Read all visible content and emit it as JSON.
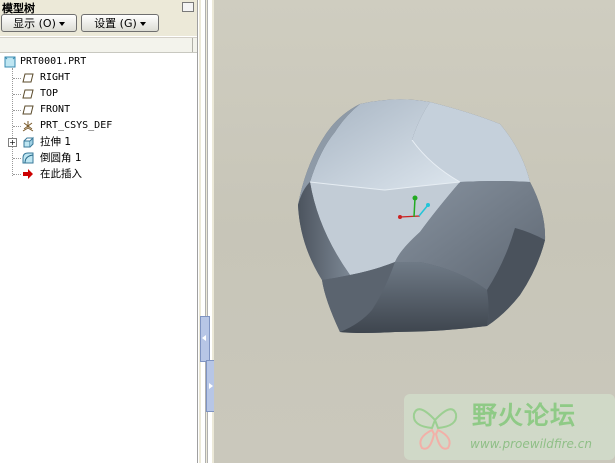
{
  "panel": {
    "title": "模型树",
    "display_button": "显示 (O)",
    "settings_button": "设置 (G)"
  },
  "tree": {
    "root": "PRT0001.PRT",
    "items": [
      {
        "label": "RIGHT",
        "icon": "datum-plane-icon"
      },
      {
        "label": "TOP",
        "icon": "datum-plane-icon"
      },
      {
        "label": "FRONT",
        "icon": "datum-plane-icon"
      },
      {
        "label": "PRT_CSYS_DEF",
        "icon": "coordinate-system-icon"
      },
      {
        "label": "拉伸 1",
        "icon": "extrude-icon"
      },
      {
        "label": "倒圆角 1",
        "icon": "round-icon"
      },
      {
        "label": "在此插入",
        "icon": "insert-here-arrow-icon"
      }
    ]
  },
  "watermark": {
    "title": "野火论坛",
    "url": "www.proewildfire.cn"
  },
  "colors": {
    "graphics_bg": "#c9c7ba",
    "panel_bg": "#ece9d8",
    "insert_arrow": "#cc0000",
    "watermark_green": "#8fca86"
  }
}
